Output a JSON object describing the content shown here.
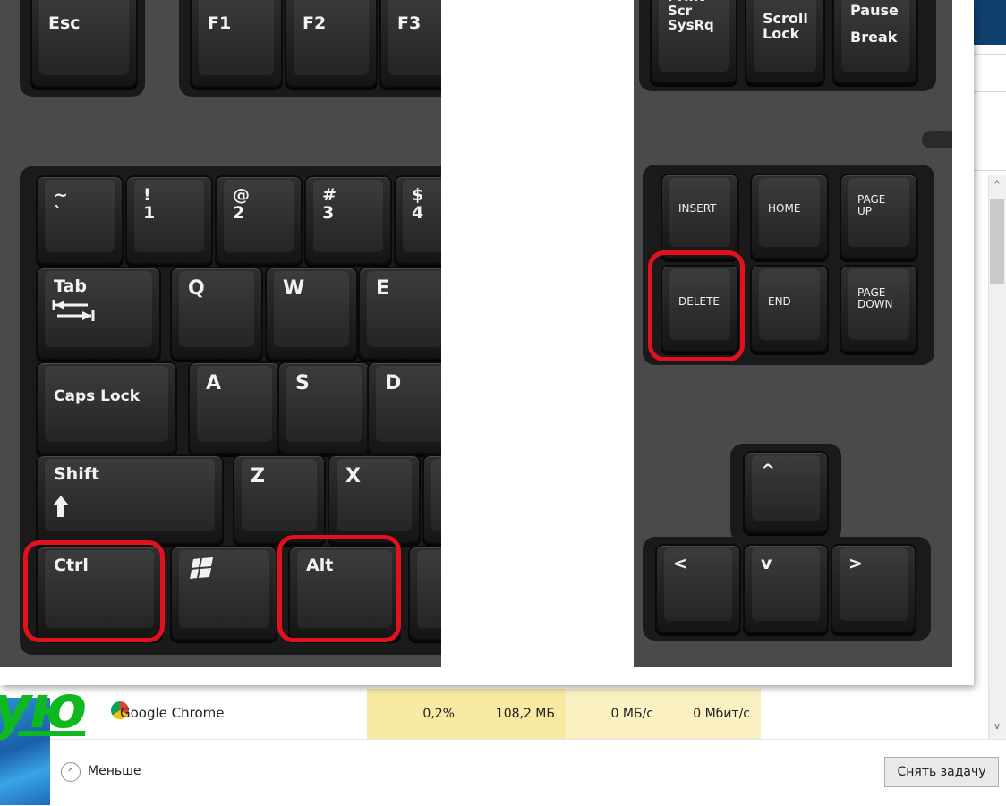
{
  "task_manager": {
    "process": {
      "name": "Google Chrome",
      "cpu": "0,2%",
      "memory": "108,2 МБ",
      "disk": "0 МБ/с",
      "network": "0 Мбит/с"
    },
    "less_label": "Меньше",
    "end_task_label": "Снять задачу",
    "scroll_up_glyph": "^",
    "scroll_down_glyph": "v",
    "less_icon_glyph": "^"
  },
  "overlay_word": "ую",
  "keyboard": {
    "left_keys": {
      "esc": "Esc",
      "f1": "F1",
      "f2": "F2",
      "f3": "F3",
      "tilde": "~\n`",
      "one": "!\n1",
      "two": "@\n2",
      "three": "#\n3",
      "four": "$\n4",
      "tab": "Tab",
      "q": "Q",
      "w": "W",
      "e": "E",
      "caps": "Caps Lock",
      "a": "A",
      "s": "S",
      "d": "D",
      "shift": "Shift",
      "z": "Z",
      "x": "X",
      "ctrl": "Ctrl",
      "alt": "Alt"
    },
    "right_keys": {
      "print": "Print\nScr\nSysRq",
      "scroll": "Scroll\nLock",
      "pause": "Pause\nBreak",
      "insert": "INSERT",
      "home": "HOME",
      "page_up": "PAGE\nUP",
      "delete": "DELETE",
      "end": "END",
      "page_down": "PAGE\nDOWN",
      "up": "^",
      "left": "<",
      "down": "v",
      "right": ">"
    },
    "highlight_color": "#e3101d",
    "windows_icon": "windows-logo-icon"
  }
}
